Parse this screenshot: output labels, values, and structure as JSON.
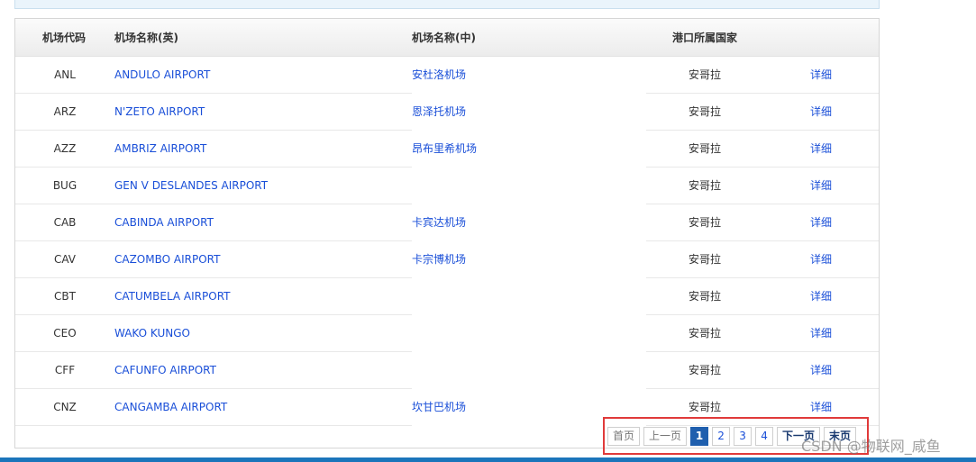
{
  "table": {
    "headers": {
      "code": "机场代码",
      "name_en": "机场名称(英)",
      "name_cn": "机场名称(中)",
      "country": "港口所属国家"
    },
    "rows": [
      {
        "code": "ANL",
        "name_en": "ANDULO AIRPORT",
        "name_cn": "安杜洛机场",
        "country": "安哥拉",
        "detail": "详细"
      },
      {
        "code": "ARZ",
        "name_en": "N'ZETO AIRPORT",
        "name_cn": "恩泽托机场",
        "country": "安哥拉",
        "detail": "详细"
      },
      {
        "code": "AZZ",
        "name_en": "AMBRIZ AIRPORT",
        "name_cn": "昂布里希机场",
        "country": "安哥拉",
        "detail": "详细"
      },
      {
        "code": "BUG",
        "name_en": "GEN V DESLANDES AIRPORT",
        "name_cn": "",
        "country": "安哥拉",
        "detail": "详细"
      },
      {
        "code": "CAB",
        "name_en": "CABINDA AIRPORT",
        "name_cn": "卡宾达机场",
        "country": "安哥拉",
        "detail": "详细"
      },
      {
        "code": "CAV",
        "name_en": "CAZOMBO AIRPORT",
        "name_cn": "卡宗博机场",
        "country": "安哥拉",
        "detail": "详细"
      },
      {
        "code": "CBT",
        "name_en": "CATUMBELA AIRPORT",
        "name_cn": "",
        "country": "安哥拉",
        "detail": "详细"
      },
      {
        "code": "CEO",
        "name_en": "WAKO KUNGO",
        "name_cn": "",
        "country": "安哥拉",
        "detail": "详细"
      },
      {
        "code": "CFF",
        "name_en": "CAFUNFO AIRPORT",
        "name_cn": "",
        "country": "安哥拉",
        "detail": "详细"
      },
      {
        "code": "CNZ",
        "name_en": "CANGAMBA AIRPORT",
        "name_cn": "坎甘巴机场",
        "country": "安哥拉",
        "detail": "详细"
      }
    ]
  },
  "pagination": {
    "first": "首页",
    "prev": "上一页",
    "pages": [
      "1",
      "2",
      "3",
      "4"
    ],
    "current": "1",
    "next": "下一页",
    "last": "末页"
  },
  "watermark": "CSDN @物联网_咸鱼",
  "colors": {
    "link": "#1a4fd8",
    "active_page": "#1f5fae",
    "highlight_box": "#e03a3a",
    "bottom_bar": "#1b75bb"
  }
}
